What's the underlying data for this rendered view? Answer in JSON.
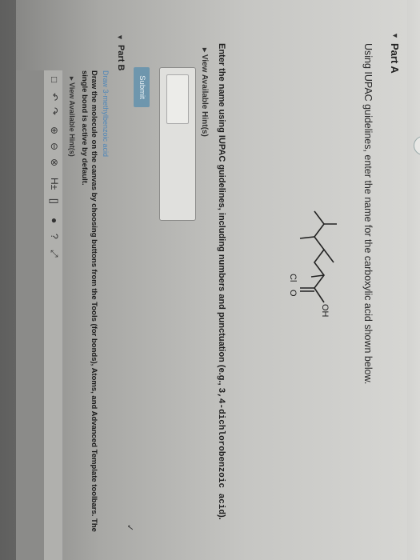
{
  "partA": {
    "title": "Part A",
    "question": "Using IUPAC guidelines, enter the name for the carboxylic acid shown below.",
    "instruction_prefix": "Enter the name using IUPAC guidelines, including numbers and punctuation (e.g., ",
    "instruction_example": "3,4-dichlorobenzoic acid",
    "instruction_suffix": ").",
    "hints_label": "View Available Hint(s)",
    "submit_label": "Submit"
  },
  "molecule": {
    "label_oh": "OH",
    "label_cl": "Cl",
    "label_o": "O"
  },
  "partB": {
    "title": "Part B",
    "subtitle": "Draw 3-methylbenzoic acid",
    "instruction": "Draw the molecule on the canvas by choosing buttons from the Tools (for bonds), Atoms, and Advanced Template toolbars. The single bond is active by default.",
    "hints_label": "View Available Hint(s)"
  },
  "toolbar": {
    "tools": [
      "□",
      "↶",
      "↷",
      "⊕",
      "⊖",
      "⊗",
      "H±",
      "[]",
      "●",
      "?",
      "⤢"
    ]
  },
  "colors": {
    "link": "#4e86b8",
    "submit": "#6e96ad"
  }
}
